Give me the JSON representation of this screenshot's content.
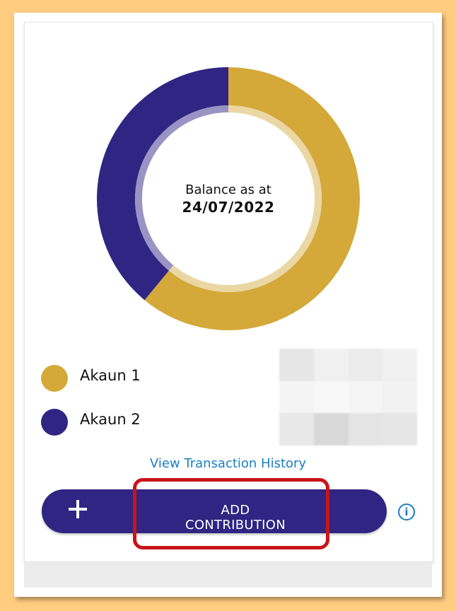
{
  "balance": {
    "caption": "Balance as at",
    "date": "24/07/2022"
  },
  "accounts": [
    {
      "label": "Akaun 1",
      "color": "#D4A93A",
      "share": 0.61
    },
    {
      "label": "Akaun 2",
      "color": "#302582",
      "share": 0.39
    }
  ],
  "actions": {
    "history_link": "View Transaction History",
    "add_label": "ADD CONTRIBUTION",
    "add_icon": "plus-icon",
    "info_icon": "info-icon",
    "info_glyph": "i"
  },
  "colors": {
    "primary": "#302582",
    "accent": "#D4A93A",
    "link": "#1a7fc4",
    "highlight": "#c8141a"
  }
}
